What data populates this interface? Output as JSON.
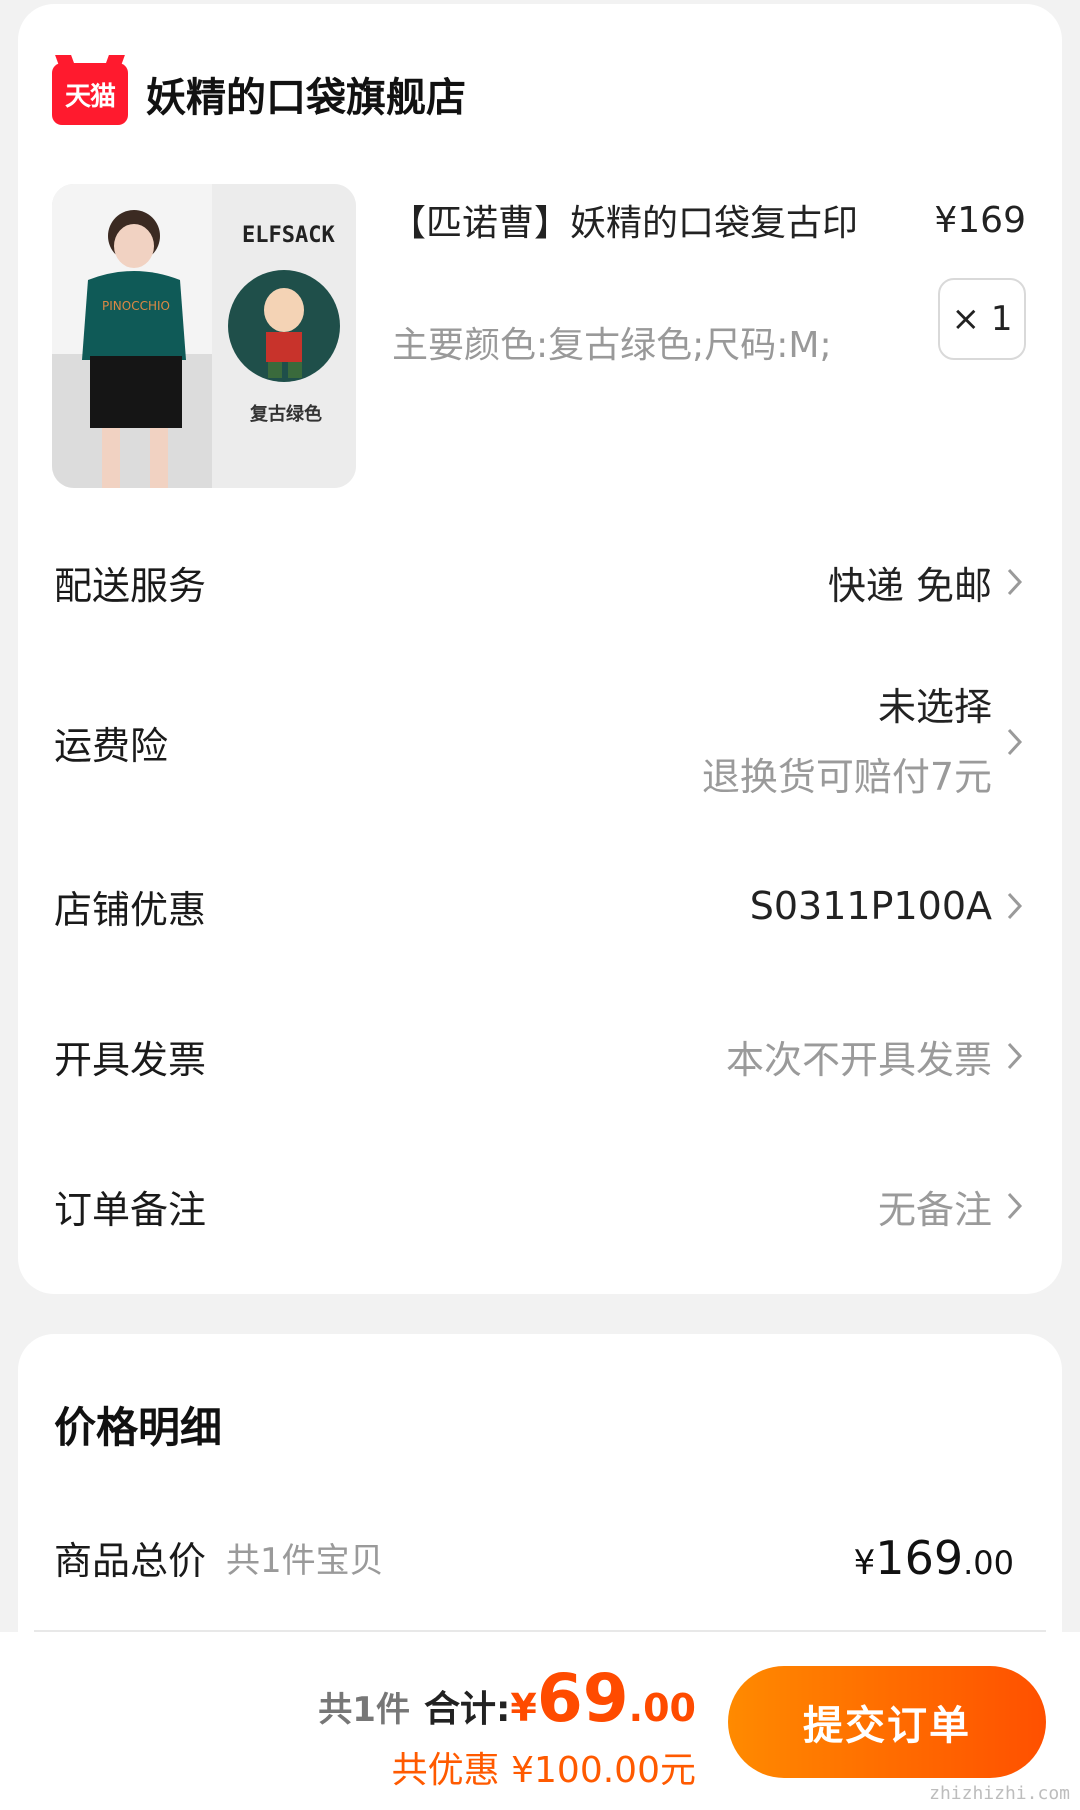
{
  "store": {
    "logo_text": "天猫",
    "name": "妖精的口袋旗舰店"
  },
  "product": {
    "image_caption_top": "ELFSACK",
    "image_caption_bottom": "复古绿色",
    "title": "【匹诺曹】妖精的口袋复古印",
    "price": "¥169",
    "sku": "主要颜色:复古绿色;尺码:M;",
    "quantity": "× 1"
  },
  "options": {
    "delivery": {
      "label": "配送服务",
      "value": "快递 免邮"
    },
    "insurance": {
      "label": "运费险",
      "value": "未选择",
      "sub": "退换货可赔付7元"
    },
    "coupon": {
      "label": "店铺优惠",
      "value": "S0311P100A"
    },
    "invoice": {
      "label": "开具发票",
      "value": "本次不开具发票"
    },
    "note": {
      "label": "订单备注",
      "value": "无备注"
    }
  },
  "price_details": {
    "title": "价格明细",
    "goods_total_label": "商品总价",
    "goods_total_sub": "共1件宝贝",
    "goods_total_currency": "¥",
    "goods_total_int": "169",
    "goods_total_dec": ".00"
  },
  "bottom_bar": {
    "count": "共1件",
    "total_label": "合计:",
    "total_currency": "¥",
    "total_int": "69",
    "total_dec": ".00",
    "discount": "共优惠 ¥100.00元",
    "submit": "提交订单"
  },
  "watermark": "zhizhizhi.com",
  "colors": {
    "accent": "#ff5000",
    "tmall_red": "#ff1a2e"
  }
}
